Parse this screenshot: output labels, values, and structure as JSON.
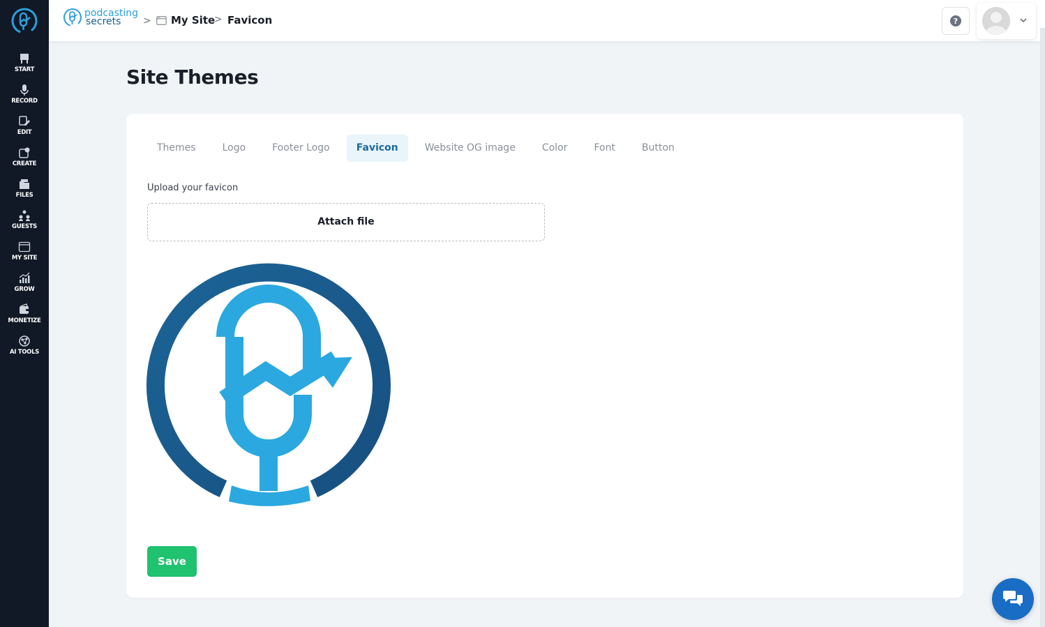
{
  "sidebar": {
    "items": [
      {
        "label": "START",
        "icon": "start-icon"
      },
      {
        "label": "RECORD",
        "icon": "microphone-icon"
      },
      {
        "label": "EDIT",
        "icon": "edit-icon"
      },
      {
        "label": "CREATE",
        "icon": "create-icon"
      },
      {
        "label": "FILES",
        "icon": "files-icon"
      },
      {
        "label": "GUESTS",
        "icon": "guests-icon"
      },
      {
        "label": "MY SITE",
        "icon": "site-icon"
      },
      {
        "label": "GROW",
        "icon": "grow-icon"
      },
      {
        "label": "MONETIZE",
        "icon": "monetize-icon"
      },
      {
        "label": "AI TOOLS",
        "icon": "ai-tools-icon"
      }
    ]
  },
  "header": {
    "brand_line1": "podcasting",
    "brand_line2": "secrets",
    "breadcrumb": {
      "separator": ">",
      "parent": "My Site",
      "current": "Favicon"
    }
  },
  "page": {
    "title": "Site Themes"
  },
  "tabs": [
    {
      "label": "Themes",
      "active": false
    },
    {
      "label": "Logo",
      "active": false
    },
    {
      "label": "Footer Logo",
      "active": false
    },
    {
      "label": "Favicon",
      "active": true
    },
    {
      "label": "Website OG image",
      "active": false
    },
    {
      "label": "Color",
      "active": false
    },
    {
      "label": "Font",
      "active": false
    },
    {
      "label": "Button",
      "active": false
    }
  ],
  "upload": {
    "label": "Upload your favicon",
    "button": "Attach file"
  },
  "actions": {
    "save": "Save"
  },
  "colors": {
    "sidebar_bg": "#111826",
    "accent_blue": "#2ba0dc",
    "dark_blue": "#1a5f8c",
    "save_green": "#1ec26f",
    "chat_blue": "#1a6dc4"
  }
}
